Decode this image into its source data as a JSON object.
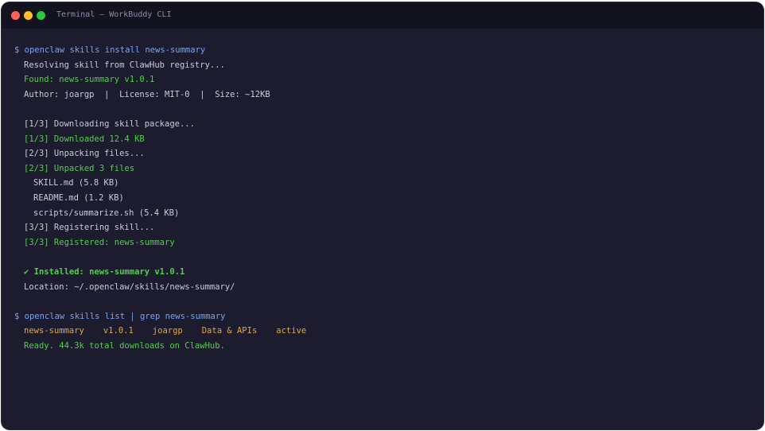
{
  "window": {
    "title": "Terminal — WorkBuddy CLI"
  },
  "terminal": {
    "cmd1": "$ openclaw skills install news-summary",
    "resolving": "Resolving skill from ClawHub registry...",
    "found": "Found: news-summary v1.0.1",
    "meta": "Author: joargp  |  License: MIT-0  |  Size: ~12KB",
    "step1": "[1/3] Downloading skill package...",
    "step1_done": "[1/3] Downloaded 12.4 KB",
    "step2": "[2/3] Unpacking files...",
    "step2_done": "[2/3] Unpacked 3 files",
    "files": [
      "SKILL.md (5.8 KB)",
      "README.md (1.2 KB)",
      "scripts/summarize.sh (5.4 KB)"
    ],
    "step3": "[3/3] Registering skill...",
    "step3_done": "[3/3] Registered: news-summary",
    "installed": "✔ Installed: news-summary v1.0.1",
    "location": "Location: ~/.openclaw/skills/news-summary/",
    "cmd2": "$ openclaw skills list | grep news-summary",
    "list_row": [
      "news-summary",
      "v1.0.1",
      "joargp",
      "Data & APIs",
      "active"
    ],
    "ready": "Ready. 44.3k total downloads on ClawHub."
  },
  "colors": {
    "command": "#7aa2f7",
    "success": "#4fd14a",
    "highlight": "#e5a63c",
    "text": "#c8ccdc",
    "background": "#1c1c2e"
  }
}
